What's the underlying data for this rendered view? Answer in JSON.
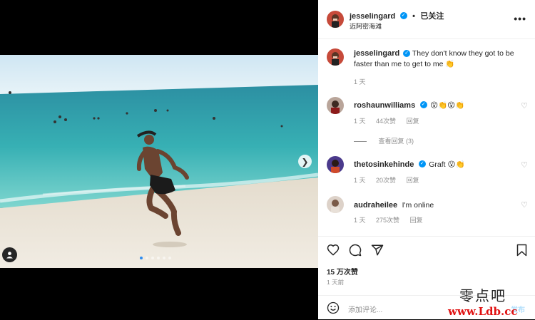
{
  "post": {
    "author": "jesselingard",
    "follow_label": "已关注",
    "location": "迈阿密海滩",
    "caption": "They don't know they got to be faster than me to get to me",
    "caption_time": "1 天"
  },
  "comments": [
    {
      "user": "roshaunwilliams",
      "text": "😮👏😮👏",
      "time": "1 天",
      "likes": "44次赞",
      "reply": "回复",
      "view_replies": "查看回复 (3)"
    },
    {
      "user": "thetosinkehinde",
      "text": "Graft 😮👏",
      "time": "1 天",
      "likes": "20次赞",
      "reply": "回复"
    },
    {
      "user": "audraheilee",
      "text": "I'm online",
      "time": "1 天",
      "likes": "275次赞",
      "reply": "回复"
    }
  ],
  "actions": {
    "likes": "15 万次赞",
    "time": "1 天前"
  },
  "composer": {
    "placeholder": "添加评论...",
    "post_label": "发布"
  },
  "watermark": {
    "cn": "零点吧",
    "url": "www.Ldb.cc"
  },
  "carousel": {
    "total": 6,
    "active": 1
  },
  "icons": {
    "heart": "heart-icon",
    "comment": "comment-icon",
    "share": "share-icon",
    "bookmark": "bookmark-icon",
    "emoji": "emoji-icon",
    "more": "more-icon",
    "next": "chevron-right-icon",
    "tag": "user-tag-icon"
  },
  "colors": {
    "accent": "#0095f6",
    "watermark_url": "#e01010"
  }
}
